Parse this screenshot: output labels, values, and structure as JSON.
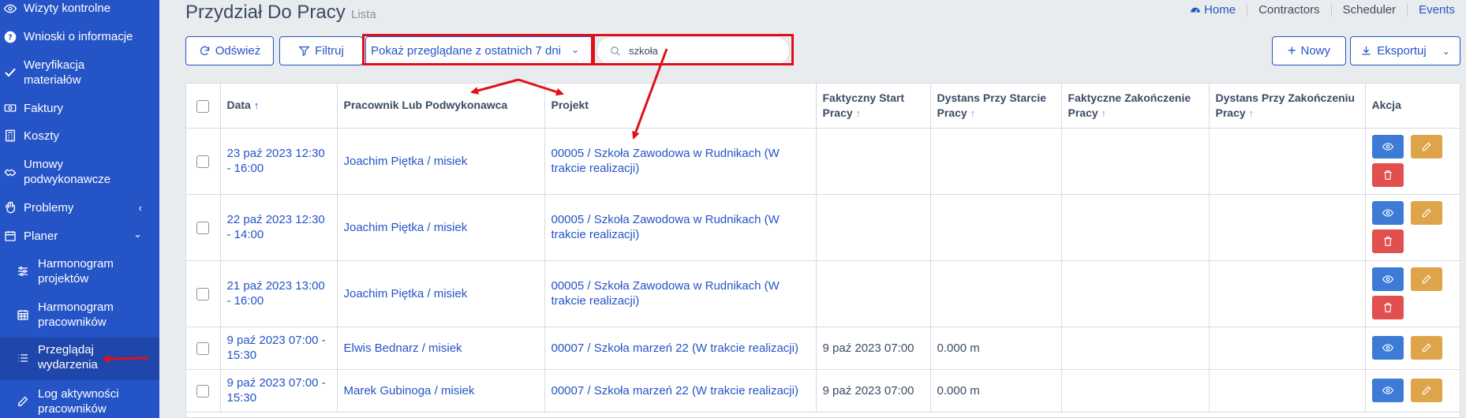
{
  "sidebar": {
    "items": [
      {
        "label": "Wizyty kontrolne",
        "icon": "eye-icon"
      },
      {
        "label": "Wnioski o informacje",
        "icon": "question-circle-icon"
      },
      {
        "label": "Weryfikacja materiałów",
        "icon": "check-icon"
      },
      {
        "label": "Faktury",
        "icon": "banknote-icon"
      },
      {
        "label": "Koszty",
        "icon": "calculator-icon"
      },
      {
        "label": "Umowy podwykonawcze",
        "icon": "handshake-icon"
      },
      {
        "label": "Problemy",
        "icon": "hand-icon",
        "chevron": "‹"
      },
      {
        "label": "Planer",
        "icon": "calendar-icon",
        "chevron": "⌄"
      },
      {
        "label": "Harmonogram projektów",
        "icon": "sliders-icon"
      },
      {
        "label": "Harmonogram pracowników",
        "icon": "calendar-grid-icon"
      },
      {
        "label": "Przeglądaj wydarzenia",
        "icon": "list-icon"
      },
      {
        "label": "Log aktywności pracowników",
        "icon": "edit-icon"
      }
    ]
  },
  "header": {
    "title": "Przydział Do Pracy",
    "subtitle": "Lista"
  },
  "breadcrumb": {
    "home": "Home",
    "items": [
      "Contractors",
      "Scheduler",
      "Events"
    ]
  },
  "toolbar": {
    "refresh_label": "Odśwież",
    "filter_label": "Filtruj",
    "period_select": "Pokaż przeglądane z ostatnich 7 dni",
    "search_value": "szkoła",
    "new_label": "Nowy",
    "export_label": "Eksportuj"
  },
  "table": {
    "headers": {
      "date": "Data",
      "worker": "Pracownik Lub Podwykonawca",
      "project": "Projekt",
      "actual_start": "Faktyczny Start Pracy",
      "start_distance": "Dystans Przy Starcie Pracy",
      "actual_end": "Faktyczne Zakończenie Pracy",
      "end_distance": "Dystans Przy Zakończeniu Pracy",
      "action": "Akcja"
    },
    "rows": [
      {
        "date": "23 paź 2023 12:30 - 16:00",
        "worker": "Joachim Piętka / misiek",
        "project": "00005 / Szkoła Zawodowa w Rudnikach (W trakcie realizacji)",
        "actual_start": "",
        "start_distance": "",
        "actual_end": "",
        "end_distance": ""
      },
      {
        "date": "22 paź 2023 12:30 - 14:00",
        "worker": "Joachim Piętka / misiek",
        "project": "00005 / Szkoła Zawodowa w Rudnikach (W trakcie realizacji)",
        "actual_start": "",
        "start_distance": "",
        "actual_end": "",
        "end_distance": ""
      },
      {
        "date": "21 paź 2023 13:00 - 16:00",
        "worker": "Joachim Piętka / misiek",
        "project": "00005 / Szkoła Zawodowa w Rudnikach (W trakcie realizacji)",
        "actual_start": "",
        "start_distance": "",
        "actual_end": "",
        "end_distance": ""
      },
      {
        "date": "9 paź 2023 07:00 - 15:30",
        "worker": "Elwis Bednarz / misiek",
        "project": "00007 / Szkoła marzeń 22 (W trakcie realizacji)",
        "actual_start": "9 paź 2023 07:00",
        "start_distance": "0.000 m",
        "actual_end": "",
        "end_distance": ""
      },
      {
        "date": "9 paź 2023 07:00 - 15:30",
        "worker": "Marek Gubinoga / misiek",
        "project": "00007 / Szkoła marzeń 22 (W trakcie realizacji)",
        "actual_start": "9 paź 2023 07:00",
        "start_distance": "0.000 m",
        "actual_end": "",
        "end_distance": ""
      }
    ]
  },
  "colors": {
    "sidebar_bg": "#2554c7",
    "accent": "#2554c7",
    "annotation": "#e0101a",
    "view_button": "#3d7bd6",
    "edit_button": "#dea44a",
    "delete_button": "#e24f4f"
  }
}
